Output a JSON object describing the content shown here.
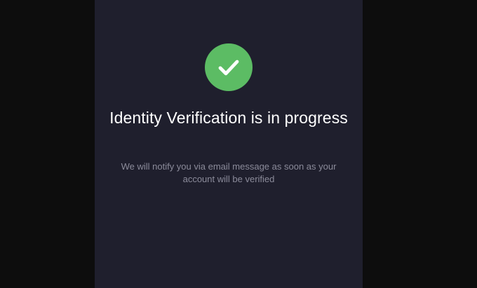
{
  "verification": {
    "icon": "check-circle-icon",
    "title": "Identity Verification is in progress",
    "message": "We will notify you via email message as soon as your account will be verified"
  },
  "colors": {
    "background": "#0d0d0d",
    "panel": "#1f1f2d",
    "success": "#5cbc64",
    "title": "#ffffff",
    "message": "#8b8b9a"
  }
}
